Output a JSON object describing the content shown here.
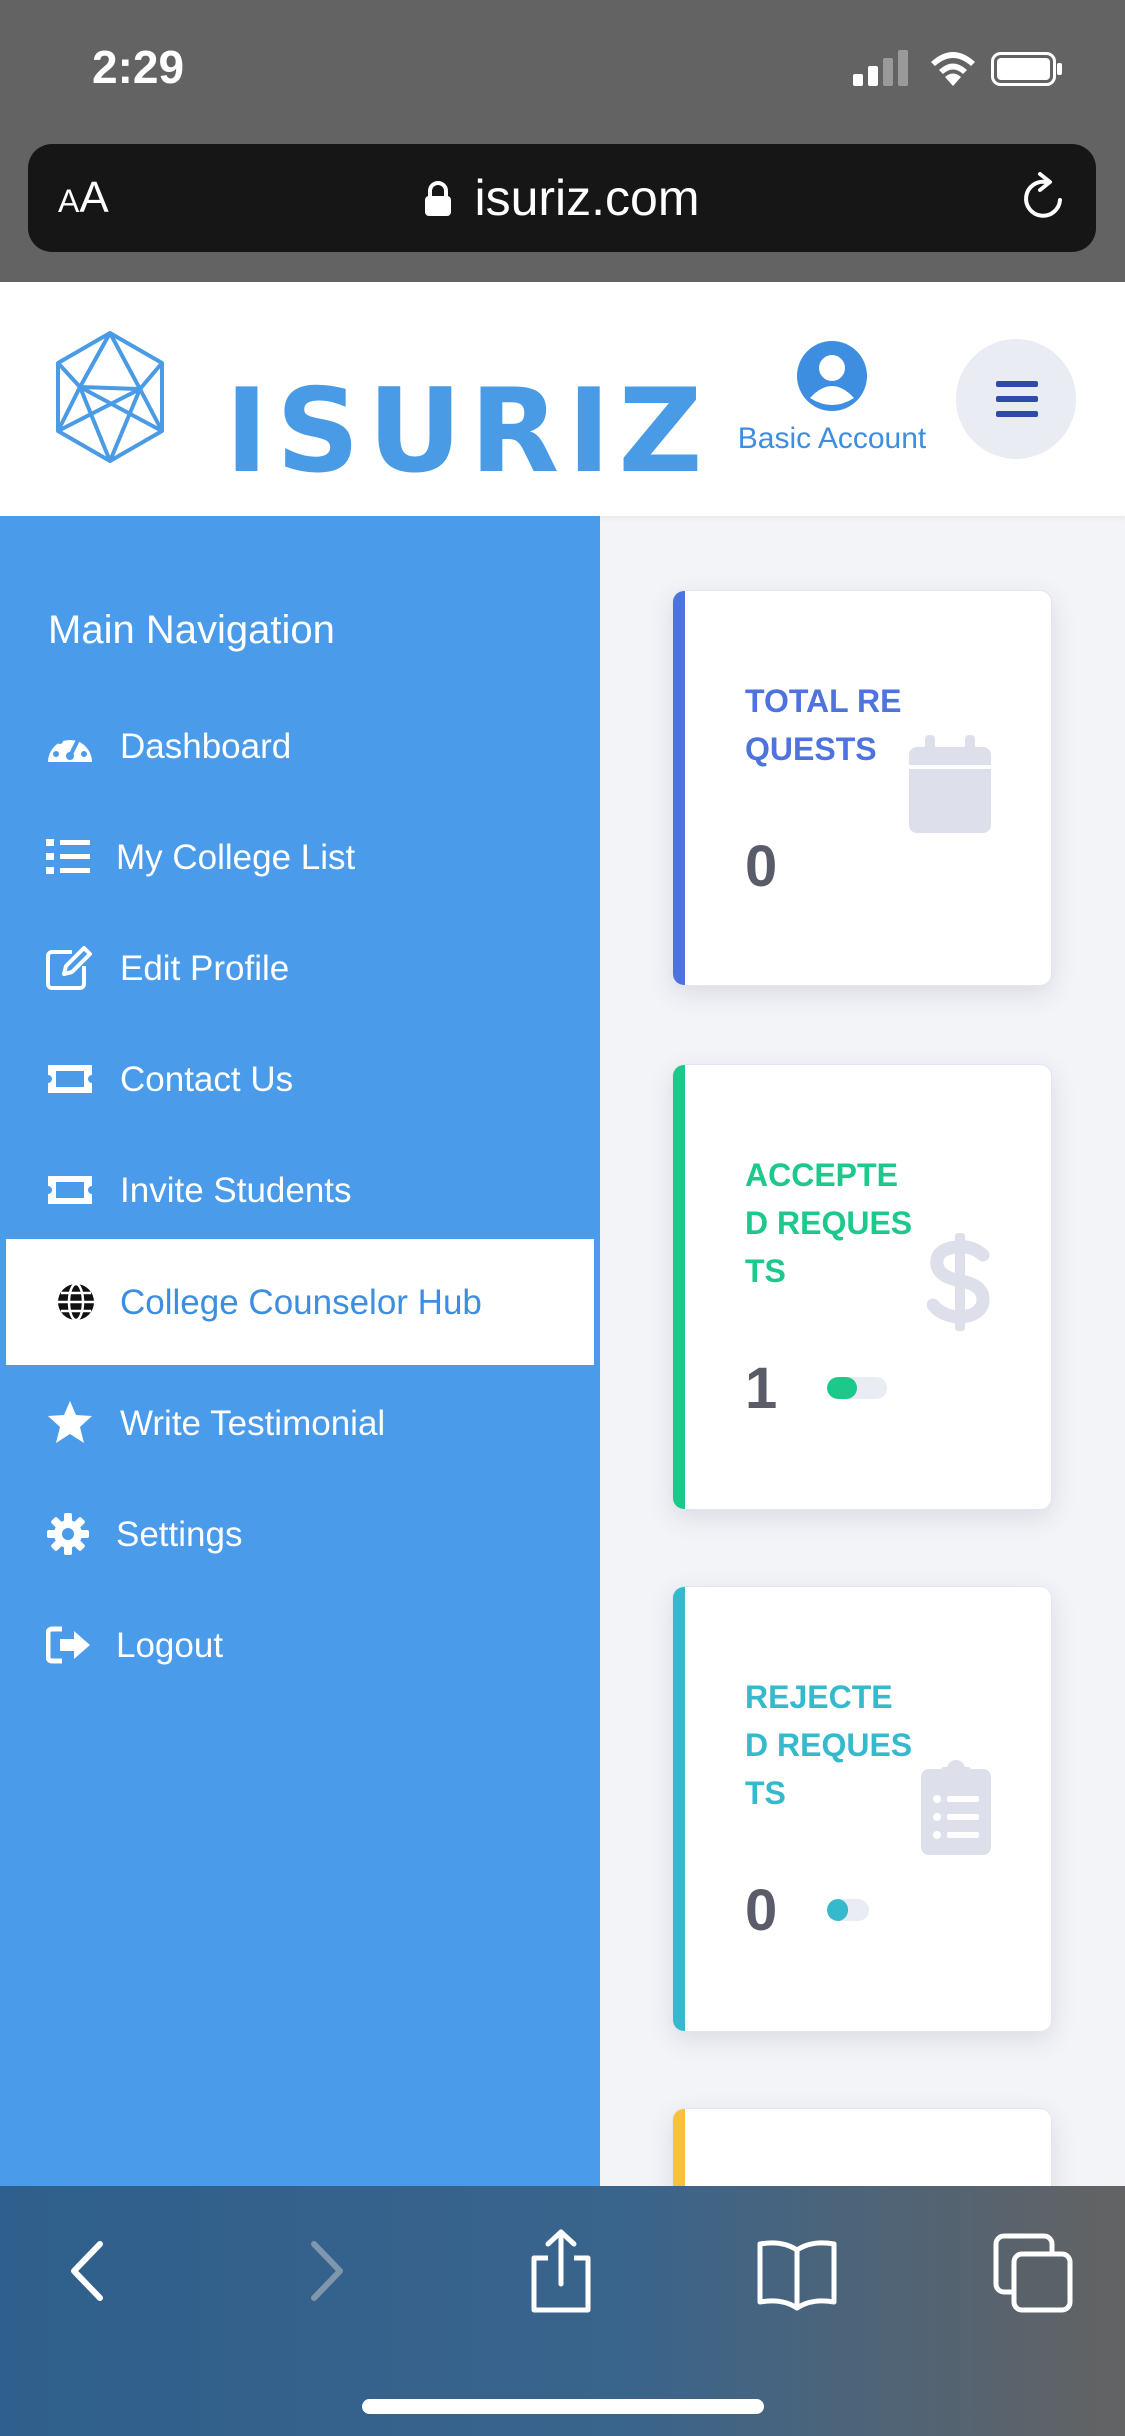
{
  "status_bar": {
    "time": "2:29"
  },
  "browser": {
    "text_size_label_small": "A",
    "text_size_label_large": "A",
    "url": "isuriz.com"
  },
  "header": {
    "logo_text": "ISURIZ",
    "account_label": "Basic Account"
  },
  "sidebar": {
    "heading": "Main Navigation",
    "items": [
      {
        "label": "Dashboard",
        "icon": "tachometer-icon"
      },
      {
        "label": "My College List",
        "icon": "list-icon"
      },
      {
        "label": "Edit Profile",
        "icon": "edit-icon"
      },
      {
        "label": "Contact Us",
        "icon": "ticket-icon"
      },
      {
        "label": "Invite Students",
        "icon": "ticket-icon"
      },
      {
        "label": "College Counselor Hub",
        "icon": "globe-icon",
        "active": true
      },
      {
        "label": "Write Testimonial",
        "icon": "star-icon"
      },
      {
        "label": "Settings",
        "icon": "gear-icon"
      },
      {
        "label": "Logout",
        "icon": "sign-out-icon"
      }
    ]
  },
  "cards": [
    {
      "title": "TOTAL REQUESTS",
      "value": "0",
      "icon": "calendar-icon",
      "color": "#4e73df"
    },
    {
      "title": "ACCEPTED REQUESTS",
      "value": "1",
      "icon": "dollar-icon",
      "color": "#1cc88a",
      "progress": 0.5
    },
    {
      "title": "REJECTED REQUESTS",
      "value": "0",
      "icon": "clipboard-icon",
      "color": "#36b9cc",
      "progress": 0.5
    }
  ],
  "colors": {
    "sidebar": "#4a9be9",
    "brand": "#4a9be5",
    "pending_accent": "#f6c23e"
  }
}
